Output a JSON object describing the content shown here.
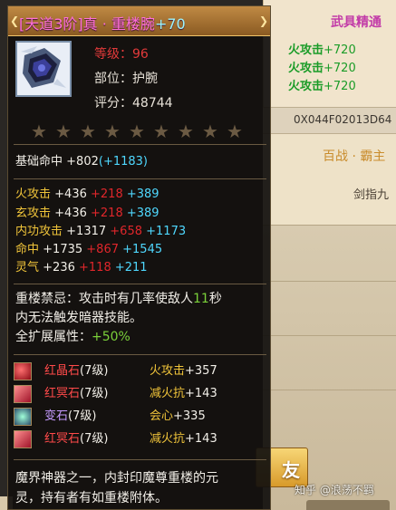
{
  "background": {
    "mastery_title": "武具精通",
    "mastery_lines": [
      {
        "name": "火攻击",
        "value": "+720"
      },
      {
        "name": "火攻击",
        "value": "+720"
      },
      {
        "name": "火攻击",
        "value": "+720"
      }
    ],
    "item_id": "0X044F02013D64",
    "char_title": "百战 · 霸主",
    "sword_text": "剑指九",
    "button_label": "友",
    "watermark": "知乎 @浪荡不羁"
  },
  "tooltip": {
    "name_prefix": "[天道3阶]真 · 重楼腕",
    "name_plus": "+70",
    "level_label": "等级：",
    "level_value": "96",
    "slot_label": "部位：",
    "slot_value": "护腕",
    "score_label": "评分：",
    "score_value": "48744",
    "stars": [
      "★",
      "★",
      "★",
      "★",
      "★",
      "★",
      "★",
      "★",
      "★"
    ],
    "base_hit": {
      "name": "基础命中",
      "base": "+802",
      "bonus": "(+1183)"
    },
    "attributes": [
      {
        "name": "火攻击",
        "base": "+436",
        "red": "+218",
        "cyan": "+389"
      },
      {
        "name": "玄攻击",
        "base": "+436",
        "red": "+218",
        "cyan": "+389"
      },
      {
        "name": "内功攻击",
        "base": "+1317",
        "red": "+658",
        "cyan": "+1173"
      },
      {
        "name": "命中",
        "base": "+1735",
        "red": "+867",
        "cyan": "+1545"
      },
      {
        "name": "灵气",
        "base": "+236",
        "red": "+118",
        "cyan": "+211"
      }
    ],
    "skill_line1_a": "重楼禁忌：攻击时有几率使敌人",
    "skill_line1_num": "11",
    "skill_line1_b": "秒",
    "skill_line2": "内无法触发暗器技能。",
    "extend_label": "全扩展属性：",
    "extend_value": "+50%",
    "gems": [
      {
        "name": "红晶石",
        "level": "(7级)",
        "attr": "火攻击",
        "value": "+357",
        "icon": "red-crystal-gem-icon"
      },
      {
        "name": "红冥石",
        "level": "(7级)",
        "attr": "减火抗",
        "value": "+143",
        "icon": "red-dark-gem-icon"
      },
      {
        "name": "变石",
        "level": "(7级)",
        "attr": "会心",
        "value": "+335",
        "icon": "change-stone-gem-icon"
      },
      {
        "name": "红冥石",
        "level": "(7级)",
        "attr": "减火抗",
        "value": "+143",
        "icon": "red-dark-gem-icon"
      }
    ],
    "lore_line1": "魔界神器之一，内封印魔尊重楼的元",
    "lore_line2": "灵，持有者有如重楼附体。"
  }
}
